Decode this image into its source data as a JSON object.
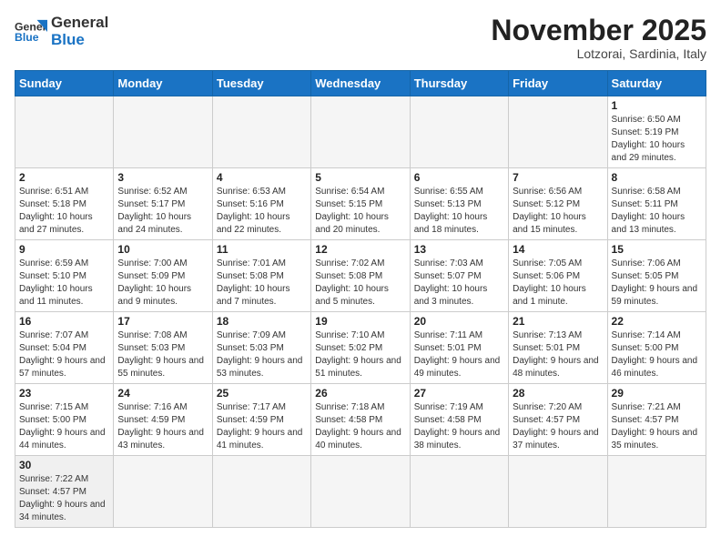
{
  "header": {
    "logo_general": "General",
    "logo_blue": "Blue",
    "month_title": "November 2025",
    "location": "Lotzorai, Sardinia, Italy"
  },
  "weekdays": [
    "Sunday",
    "Monday",
    "Tuesday",
    "Wednesday",
    "Thursday",
    "Friday",
    "Saturday"
  ],
  "weeks": [
    [
      {
        "day": "",
        "info": ""
      },
      {
        "day": "",
        "info": ""
      },
      {
        "day": "",
        "info": ""
      },
      {
        "day": "",
        "info": ""
      },
      {
        "day": "",
        "info": ""
      },
      {
        "day": "",
        "info": ""
      },
      {
        "day": "1",
        "info": "Sunrise: 6:50 AM\nSunset: 5:19 PM\nDaylight: 10 hours and 29 minutes."
      }
    ],
    [
      {
        "day": "2",
        "info": "Sunrise: 6:51 AM\nSunset: 5:18 PM\nDaylight: 10 hours and 27 minutes."
      },
      {
        "day": "3",
        "info": "Sunrise: 6:52 AM\nSunset: 5:17 PM\nDaylight: 10 hours and 24 minutes."
      },
      {
        "day": "4",
        "info": "Sunrise: 6:53 AM\nSunset: 5:16 PM\nDaylight: 10 hours and 22 minutes."
      },
      {
        "day": "5",
        "info": "Sunrise: 6:54 AM\nSunset: 5:15 PM\nDaylight: 10 hours and 20 minutes."
      },
      {
        "day": "6",
        "info": "Sunrise: 6:55 AM\nSunset: 5:13 PM\nDaylight: 10 hours and 18 minutes."
      },
      {
        "day": "7",
        "info": "Sunrise: 6:56 AM\nSunset: 5:12 PM\nDaylight: 10 hours and 15 minutes."
      },
      {
        "day": "8",
        "info": "Sunrise: 6:58 AM\nSunset: 5:11 PM\nDaylight: 10 hours and 13 minutes."
      }
    ],
    [
      {
        "day": "9",
        "info": "Sunrise: 6:59 AM\nSunset: 5:10 PM\nDaylight: 10 hours and 11 minutes."
      },
      {
        "day": "10",
        "info": "Sunrise: 7:00 AM\nSunset: 5:09 PM\nDaylight: 10 hours and 9 minutes."
      },
      {
        "day": "11",
        "info": "Sunrise: 7:01 AM\nSunset: 5:08 PM\nDaylight: 10 hours and 7 minutes."
      },
      {
        "day": "12",
        "info": "Sunrise: 7:02 AM\nSunset: 5:08 PM\nDaylight: 10 hours and 5 minutes."
      },
      {
        "day": "13",
        "info": "Sunrise: 7:03 AM\nSunset: 5:07 PM\nDaylight: 10 hours and 3 minutes."
      },
      {
        "day": "14",
        "info": "Sunrise: 7:05 AM\nSunset: 5:06 PM\nDaylight: 10 hours and 1 minute."
      },
      {
        "day": "15",
        "info": "Sunrise: 7:06 AM\nSunset: 5:05 PM\nDaylight: 9 hours and 59 minutes."
      }
    ],
    [
      {
        "day": "16",
        "info": "Sunrise: 7:07 AM\nSunset: 5:04 PM\nDaylight: 9 hours and 57 minutes."
      },
      {
        "day": "17",
        "info": "Sunrise: 7:08 AM\nSunset: 5:03 PM\nDaylight: 9 hours and 55 minutes."
      },
      {
        "day": "18",
        "info": "Sunrise: 7:09 AM\nSunset: 5:03 PM\nDaylight: 9 hours and 53 minutes."
      },
      {
        "day": "19",
        "info": "Sunrise: 7:10 AM\nSunset: 5:02 PM\nDaylight: 9 hours and 51 minutes."
      },
      {
        "day": "20",
        "info": "Sunrise: 7:11 AM\nSunset: 5:01 PM\nDaylight: 9 hours and 49 minutes."
      },
      {
        "day": "21",
        "info": "Sunrise: 7:13 AM\nSunset: 5:01 PM\nDaylight: 9 hours and 48 minutes."
      },
      {
        "day": "22",
        "info": "Sunrise: 7:14 AM\nSunset: 5:00 PM\nDaylight: 9 hours and 46 minutes."
      }
    ],
    [
      {
        "day": "23",
        "info": "Sunrise: 7:15 AM\nSunset: 5:00 PM\nDaylight: 9 hours and 44 minutes."
      },
      {
        "day": "24",
        "info": "Sunrise: 7:16 AM\nSunset: 4:59 PM\nDaylight: 9 hours and 43 minutes."
      },
      {
        "day": "25",
        "info": "Sunrise: 7:17 AM\nSunset: 4:59 PM\nDaylight: 9 hours and 41 minutes."
      },
      {
        "day": "26",
        "info": "Sunrise: 7:18 AM\nSunset: 4:58 PM\nDaylight: 9 hours and 40 minutes."
      },
      {
        "day": "27",
        "info": "Sunrise: 7:19 AM\nSunset: 4:58 PM\nDaylight: 9 hours and 38 minutes."
      },
      {
        "day": "28",
        "info": "Sunrise: 7:20 AM\nSunset: 4:57 PM\nDaylight: 9 hours and 37 minutes."
      },
      {
        "day": "29",
        "info": "Sunrise: 7:21 AM\nSunset: 4:57 PM\nDaylight: 9 hours and 35 minutes."
      }
    ],
    [
      {
        "day": "30",
        "info": "Sunrise: 7:22 AM\nSunset: 4:57 PM\nDaylight: 9 hours and 34 minutes."
      },
      {
        "day": "",
        "info": ""
      },
      {
        "day": "",
        "info": ""
      },
      {
        "day": "",
        "info": ""
      },
      {
        "day": "",
        "info": ""
      },
      {
        "day": "",
        "info": ""
      },
      {
        "day": "",
        "info": ""
      }
    ]
  ]
}
